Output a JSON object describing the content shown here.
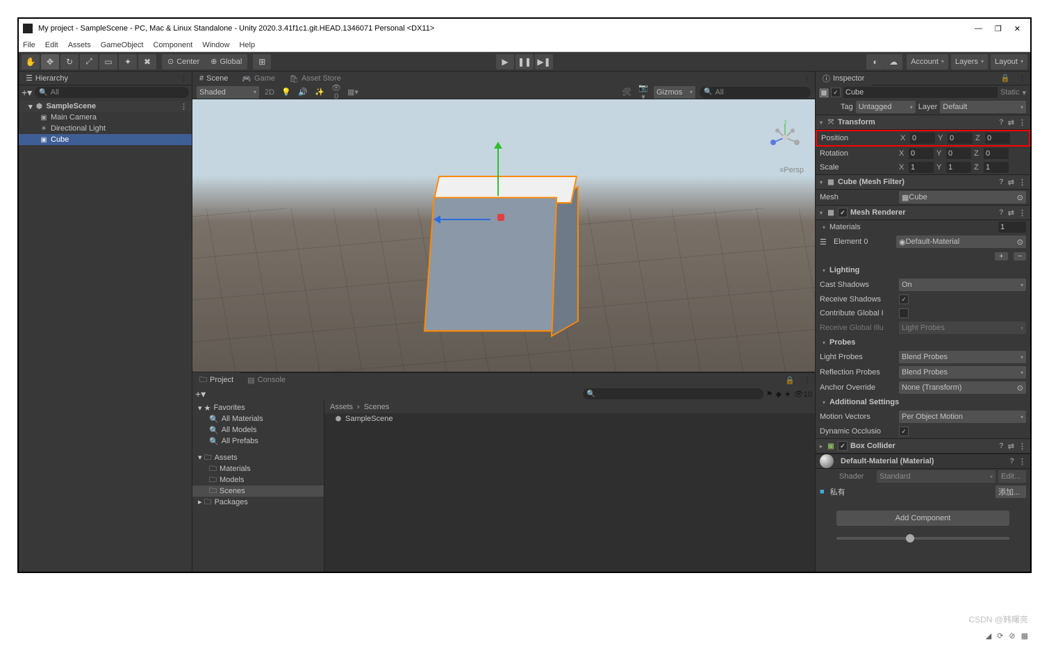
{
  "window": {
    "title": "My project - SampleScene - PC, Mac & Linux Standalone - Unity 2020.3.41f1c1.git.HEAD.1346071 Personal <DX11>"
  },
  "menu": [
    "File",
    "Edit",
    "Assets",
    "GameObject",
    "Component",
    "Window",
    "Help"
  ],
  "toolbar": {
    "center": "Center",
    "global": "Global",
    "account": "Account",
    "layers": "Layers",
    "layout": "Layout"
  },
  "hierarchy": {
    "tab": "Hierarchy",
    "search": "All",
    "scene": "SampleScene",
    "items": [
      "Main Camera",
      "Directional Light",
      "Cube"
    ],
    "selected": "Cube"
  },
  "scene": {
    "tabs": [
      "Scene",
      "Game",
      "Asset Store"
    ],
    "shading": "Shaded",
    "mode2d": "2D",
    "gizmos": "Gizmos",
    "searchAll": "All",
    "persp": "Persp"
  },
  "project": {
    "tabs": [
      "Project",
      "Console"
    ],
    "favorites": "Favorites",
    "favItems": [
      "All Materials",
      "All Models",
      "All Prefabs"
    ],
    "assets": "Assets",
    "assetItems": [
      "Materials",
      "Models",
      "Scenes"
    ],
    "packages": "Packages",
    "breadcrumb": [
      "Assets",
      "Scenes"
    ],
    "content": [
      "SampleScene"
    ],
    "hidden": "10"
  },
  "inspector": {
    "tab": "Inspector",
    "name": "Cube",
    "static": "Static",
    "tag": "Tag",
    "tagVal": "Untagged",
    "layer": "Layer",
    "layerVal": "Default",
    "transform": {
      "title": "Transform",
      "position": "Position",
      "posX": "0",
      "posY": "0",
      "posZ": "0",
      "rotation": "Rotation",
      "rotX": "0",
      "rotY": "0",
      "rotZ": "0",
      "scale": "Scale",
      "sclX": "1",
      "sclY": "1",
      "sclZ": "1"
    },
    "meshFilter": {
      "title": "Cube (Mesh Filter)",
      "meshLbl": "Mesh",
      "meshVal": "Cube"
    },
    "meshRenderer": {
      "title": "Mesh Renderer",
      "materials": "Materials",
      "size": "1",
      "element0": "Element 0",
      "element0Val": "Default-Material",
      "lighting": "Lighting",
      "castShadows": "Cast Shadows",
      "castShadowsVal": "On",
      "receiveShadows": "Receive Shadows",
      "contributeGI": "Contribute Global I",
      "receiveGI": "Receive Global Illu",
      "receiveGIVal": "Light Probes",
      "probes": "Probes",
      "lightProbes": "Light Probes",
      "lightProbesVal": "Blend Probes",
      "reflectionProbes": "Reflection Probes",
      "reflectionProbesVal": "Blend Probes",
      "anchorOverride": "Anchor Override",
      "anchorOverrideVal": "None (Transform)",
      "additional": "Additional Settings",
      "motionVectors": "Motion Vectors",
      "motionVectorsVal": "Per Object Motion",
      "dynamicOcclusion": "Dynamic Occlusio"
    },
    "boxCollider": {
      "title": "Box Collider"
    },
    "material": {
      "title": "Default-Material (Material)",
      "shader": "Shader",
      "shaderVal": "Standard",
      "edit": "Edit..."
    },
    "private": "私有",
    "addTo": "添加...",
    "addComponent": "Add Component"
  },
  "watermark": "CSDN @韩曙亮"
}
